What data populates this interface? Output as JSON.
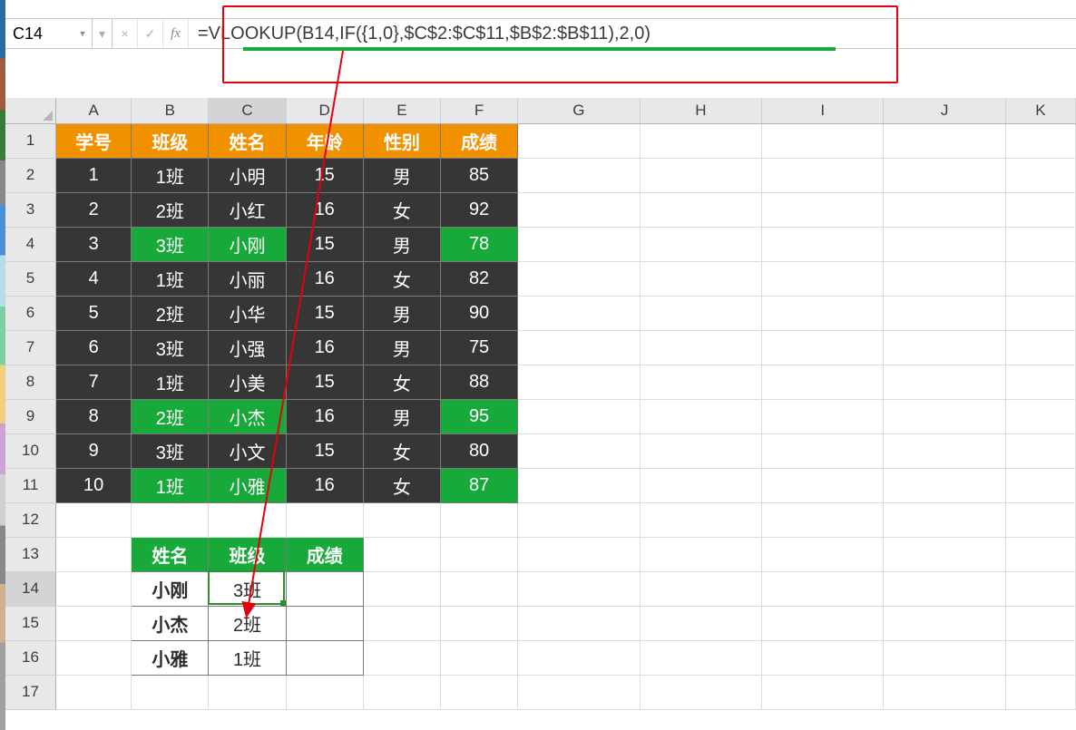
{
  "name_box": "C14",
  "formula": "=VLOOKUP(B14,IF({1,0},$C$2:$C$11,$B$2:$B$11),2,0)",
  "fb_icons": {
    "cancel": "×",
    "confirm": "✓",
    "fx": "fx"
  },
  "columns": [
    "A",
    "B",
    "C",
    "D",
    "E",
    "F",
    "G",
    "H",
    "I",
    "J",
    "K"
  ],
  "row_count": 17,
  "active_col": "C",
  "active_row": 14,
  "main_table": {
    "headers": [
      "学号",
      "班级",
      "姓名",
      "年龄",
      "性别",
      "成绩"
    ],
    "rows": [
      {
        "id": "1",
        "class": "1班",
        "name": "小明",
        "age": "15",
        "sex": "男",
        "score": "85",
        "hl": false
      },
      {
        "id": "2",
        "class": "2班",
        "name": "小红",
        "age": "16",
        "sex": "女",
        "score": "92",
        "hl": false
      },
      {
        "id": "3",
        "class": "3班",
        "name": "小刚",
        "age": "15",
        "sex": "男",
        "score": "78",
        "hl": true
      },
      {
        "id": "4",
        "class": "1班",
        "name": "小丽",
        "age": "16",
        "sex": "女",
        "score": "82",
        "hl": false
      },
      {
        "id": "5",
        "class": "2班",
        "name": "小华",
        "age": "15",
        "sex": "男",
        "score": "90",
        "hl": false
      },
      {
        "id": "6",
        "class": "3班",
        "name": "小强",
        "age": "16",
        "sex": "男",
        "score": "75",
        "hl": false
      },
      {
        "id": "7",
        "class": "1班",
        "name": "小美",
        "age": "15",
        "sex": "女",
        "score": "88",
        "hl": false
      },
      {
        "id": "8",
        "class": "2班",
        "name": "小杰",
        "age": "16",
        "sex": "男",
        "score": "95",
        "hl": true
      },
      {
        "id": "9",
        "class": "3班",
        "name": "小文",
        "age": "15",
        "sex": "女",
        "score": "80",
        "hl": false
      },
      {
        "id": "10",
        "class": "1班",
        "name": "小雅",
        "age": "16",
        "sex": "女",
        "score": "87",
        "hl": true
      }
    ]
  },
  "lookup_table": {
    "headers": [
      "姓名",
      "班级",
      "成绩"
    ],
    "rows": [
      {
        "name": "小刚",
        "class": "3班",
        "score": ""
      },
      {
        "name": "小杰",
        "class": "2班",
        "score": ""
      },
      {
        "name": "小雅",
        "class": "1班",
        "score": ""
      }
    ]
  },
  "chart_data": {
    "type": "table",
    "title": "VLOOKUP reverse lookup example",
    "columns": [
      "学号",
      "班级",
      "姓名",
      "年龄",
      "性别",
      "成绩"
    ],
    "rows": [
      [
        1,
        "1班",
        "小明",
        15,
        "男",
        85
      ],
      [
        2,
        "2班",
        "小红",
        16,
        "女",
        92
      ],
      [
        3,
        "3班",
        "小刚",
        15,
        "男",
        78
      ],
      [
        4,
        "1班",
        "小丽",
        16,
        "女",
        82
      ],
      [
        5,
        "2班",
        "小华",
        15,
        "男",
        90
      ],
      [
        6,
        "3班",
        "小强",
        16,
        "男",
        75
      ],
      [
        7,
        "1班",
        "小美",
        15,
        "女",
        88
      ],
      [
        8,
        "2班",
        "小杰",
        16,
        "男",
        95
      ],
      [
        9,
        "3班",
        "小文",
        15,
        "女",
        80
      ],
      [
        10,
        "1班",
        "小雅",
        16,
        "女",
        87
      ]
    ],
    "lookup": {
      "columns": [
        "姓名",
        "班级",
        "成绩"
      ],
      "rows": [
        [
          "小刚",
          "3班",
          null
        ],
        [
          "小杰",
          "2班",
          null
        ],
        [
          "小雅",
          "1班",
          null
        ]
      ]
    }
  }
}
